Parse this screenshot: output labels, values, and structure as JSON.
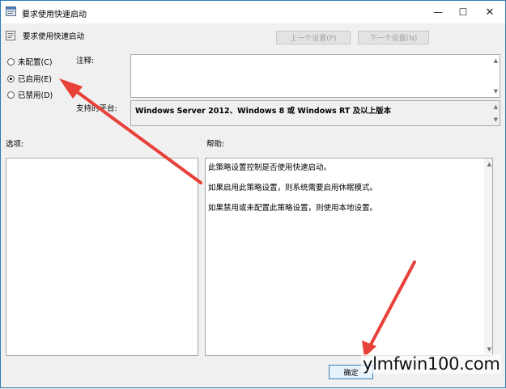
{
  "window": {
    "title": "要求使用快速启动",
    "controls": {
      "minimize": "—",
      "maximize": "☐",
      "close": "✕"
    }
  },
  "header": {
    "policy_title": "要求使用快速启动",
    "prev_button": "上一个设置(P)",
    "next_button": "下一个设置(N)"
  },
  "state": {
    "options": [
      {
        "label": "未配置(C)",
        "selected": false
      },
      {
        "label": "已启用(E)",
        "selected": true
      },
      {
        "label": "已禁用(D)",
        "selected": false
      }
    ]
  },
  "comment": {
    "label": "注释:",
    "value": ""
  },
  "platform": {
    "label": "支持的平台:",
    "value": "Windows Server 2012、Windows 8 或 Windows RT 及以上版本"
  },
  "options_panel": {
    "label": "选项:"
  },
  "help_panel": {
    "label": "帮助:",
    "lines": [
      "此策略设置控制是否使用快速启动。",
      "如果启用此策略设置，则系统需要启用休眠模式。",
      "如果禁用或未配置此策略设置，则使用本地设置。"
    ]
  },
  "footer": {
    "ok_button": "确定"
  },
  "watermark": "ylmfwin100.com",
  "annotation_color": "#e8413a"
}
